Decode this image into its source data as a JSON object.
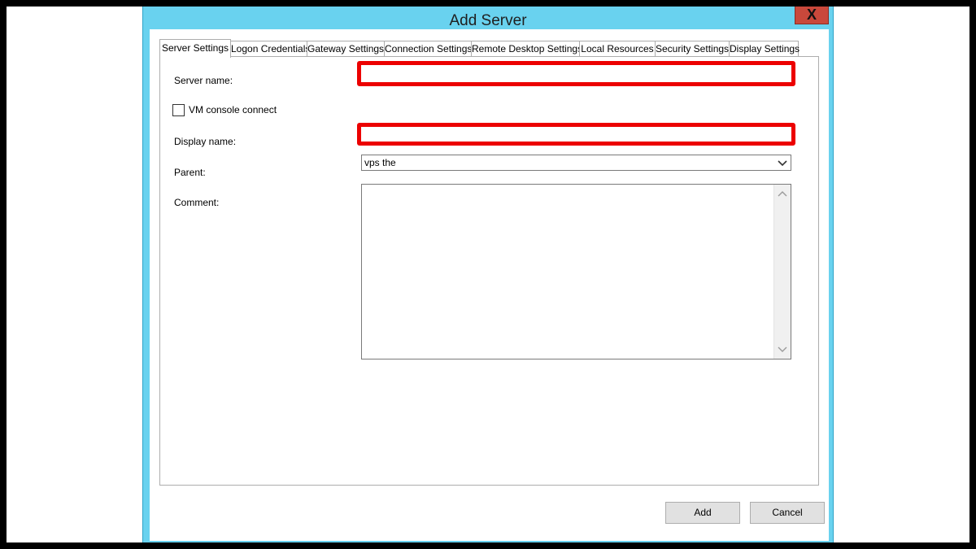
{
  "dialog": {
    "title": "Add Server",
    "close_label": "X",
    "tabs": [
      {
        "label": "Server Settings",
        "active": true
      },
      {
        "label": "Logon Credentials"
      },
      {
        "label": "Gateway Settings"
      },
      {
        "label": "Connection Settings"
      },
      {
        "label": "Remote Desktop Settings"
      },
      {
        "label": "Local Resources"
      },
      {
        "label": "Security Settings"
      },
      {
        "label": "Display Settings"
      }
    ]
  },
  "form": {
    "server_name_label": "Server name:",
    "server_name_value": "",
    "vm_console_label": "VM console connect",
    "vm_console_checked": false,
    "display_name_label": "Display name:",
    "display_name_value": "",
    "parent_label": "Parent:",
    "parent_value": "vps the",
    "comment_label": "Comment:",
    "comment_value": "",
    "highlight_color": "#ec0000"
  },
  "buttons": {
    "add_label": "Add",
    "cancel_label": "Cancel"
  }
}
